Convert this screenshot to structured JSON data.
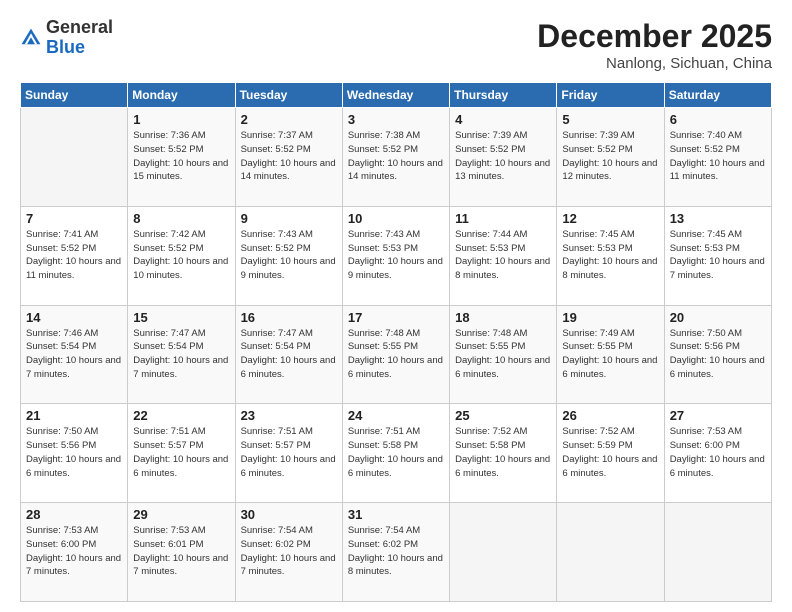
{
  "header": {
    "logo_general": "General",
    "logo_blue": "Blue",
    "month_title": "December 2025",
    "location": "Nanlong, Sichuan, China"
  },
  "days_of_week": [
    "Sunday",
    "Monday",
    "Tuesday",
    "Wednesday",
    "Thursday",
    "Friday",
    "Saturday"
  ],
  "weeks": [
    [
      {
        "day": "",
        "info": ""
      },
      {
        "day": "1",
        "info": "Sunrise: 7:36 AM\nSunset: 5:52 PM\nDaylight: 10 hours\nand 15 minutes."
      },
      {
        "day": "2",
        "info": "Sunrise: 7:37 AM\nSunset: 5:52 PM\nDaylight: 10 hours\nand 14 minutes."
      },
      {
        "day": "3",
        "info": "Sunrise: 7:38 AM\nSunset: 5:52 PM\nDaylight: 10 hours\nand 14 minutes."
      },
      {
        "day": "4",
        "info": "Sunrise: 7:39 AM\nSunset: 5:52 PM\nDaylight: 10 hours\nand 13 minutes."
      },
      {
        "day": "5",
        "info": "Sunrise: 7:39 AM\nSunset: 5:52 PM\nDaylight: 10 hours\nand 12 minutes."
      },
      {
        "day": "6",
        "info": "Sunrise: 7:40 AM\nSunset: 5:52 PM\nDaylight: 10 hours\nand 11 minutes."
      }
    ],
    [
      {
        "day": "7",
        "info": "Sunrise: 7:41 AM\nSunset: 5:52 PM\nDaylight: 10 hours\nand 11 minutes."
      },
      {
        "day": "8",
        "info": "Sunrise: 7:42 AM\nSunset: 5:52 PM\nDaylight: 10 hours\nand 10 minutes."
      },
      {
        "day": "9",
        "info": "Sunrise: 7:43 AM\nSunset: 5:52 PM\nDaylight: 10 hours\nand 9 minutes."
      },
      {
        "day": "10",
        "info": "Sunrise: 7:43 AM\nSunset: 5:53 PM\nDaylight: 10 hours\nand 9 minutes."
      },
      {
        "day": "11",
        "info": "Sunrise: 7:44 AM\nSunset: 5:53 PM\nDaylight: 10 hours\nand 8 minutes."
      },
      {
        "day": "12",
        "info": "Sunrise: 7:45 AM\nSunset: 5:53 PM\nDaylight: 10 hours\nand 8 minutes."
      },
      {
        "day": "13",
        "info": "Sunrise: 7:45 AM\nSunset: 5:53 PM\nDaylight: 10 hours\nand 7 minutes."
      }
    ],
    [
      {
        "day": "14",
        "info": "Sunrise: 7:46 AM\nSunset: 5:54 PM\nDaylight: 10 hours\nand 7 minutes."
      },
      {
        "day": "15",
        "info": "Sunrise: 7:47 AM\nSunset: 5:54 PM\nDaylight: 10 hours\nand 7 minutes."
      },
      {
        "day": "16",
        "info": "Sunrise: 7:47 AM\nSunset: 5:54 PM\nDaylight: 10 hours\nand 6 minutes."
      },
      {
        "day": "17",
        "info": "Sunrise: 7:48 AM\nSunset: 5:55 PM\nDaylight: 10 hours\nand 6 minutes."
      },
      {
        "day": "18",
        "info": "Sunrise: 7:48 AM\nSunset: 5:55 PM\nDaylight: 10 hours\nand 6 minutes."
      },
      {
        "day": "19",
        "info": "Sunrise: 7:49 AM\nSunset: 5:55 PM\nDaylight: 10 hours\nand 6 minutes."
      },
      {
        "day": "20",
        "info": "Sunrise: 7:50 AM\nSunset: 5:56 PM\nDaylight: 10 hours\nand 6 minutes."
      }
    ],
    [
      {
        "day": "21",
        "info": "Sunrise: 7:50 AM\nSunset: 5:56 PM\nDaylight: 10 hours\nand 6 minutes."
      },
      {
        "day": "22",
        "info": "Sunrise: 7:51 AM\nSunset: 5:57 PM\nDaylight: 10 hours\nand 6 minutes."
      },
      {
        "day": "23",
        "info": "Sunrise: 7:51 AM\nSunset: 5:57 PM\nDaylight: 10 hours\nand 6 minutes."
      },
      {
        "day": "24",
        "info": "Sunrise: 7:51 AM\nSunset: 5:58 PM\nDaylight: 10 hours\nand 6 minutes."
      },
      {
        "day": "25",
        "info": "Sunrise: 7:52 AM\nSunset: 5:58 PM\nDaylight: 10 hours\nand 6 minutes."
      },
      {
        "day": "26",
        "info": "Sunrise: 7:52 AM\nSunset: 5:59 PM\nDaylight: 10 hours\nand 6 minutes."
      },
      {
        "day": "27",
        "info": "Sunrise: 7:53 AM\nSunset: 6:00 PM\nDaylight: 10 hours\nand 6 minutes."
      }
    ],
    [
      {
        "day": "28",
        "info": "Sunrise: 7:53 AM\nSunset: 6:00 PM\nDaylight: 10 hours\nand 7 minutes."
      },
      {
        "day": "29",
        "info": "Sunrise: 7:53 AM\nSunset: 6:01 PM\nDaylight: 10 hours\nand 7 minutes."
      },
      {
        "day": "30",
        "info": "Sunrise: 7:54 AM\nSunset: 6:02 PM\nDaylight: 10 hours\nand 7 minutes."
      },
      {
        "day": "31",
        "info": "Sunrise: 7:54 AM\nSunset: 6:02 PM\nDaylight: 10 hours\nand 8 minutes."
      },
      {
        "day": "",
        "info": ""
      },
      {
        "day": "",
        "info": ""
      },
      {
        "day": "",
        "info": ""
      }
    ]
  ]
}
